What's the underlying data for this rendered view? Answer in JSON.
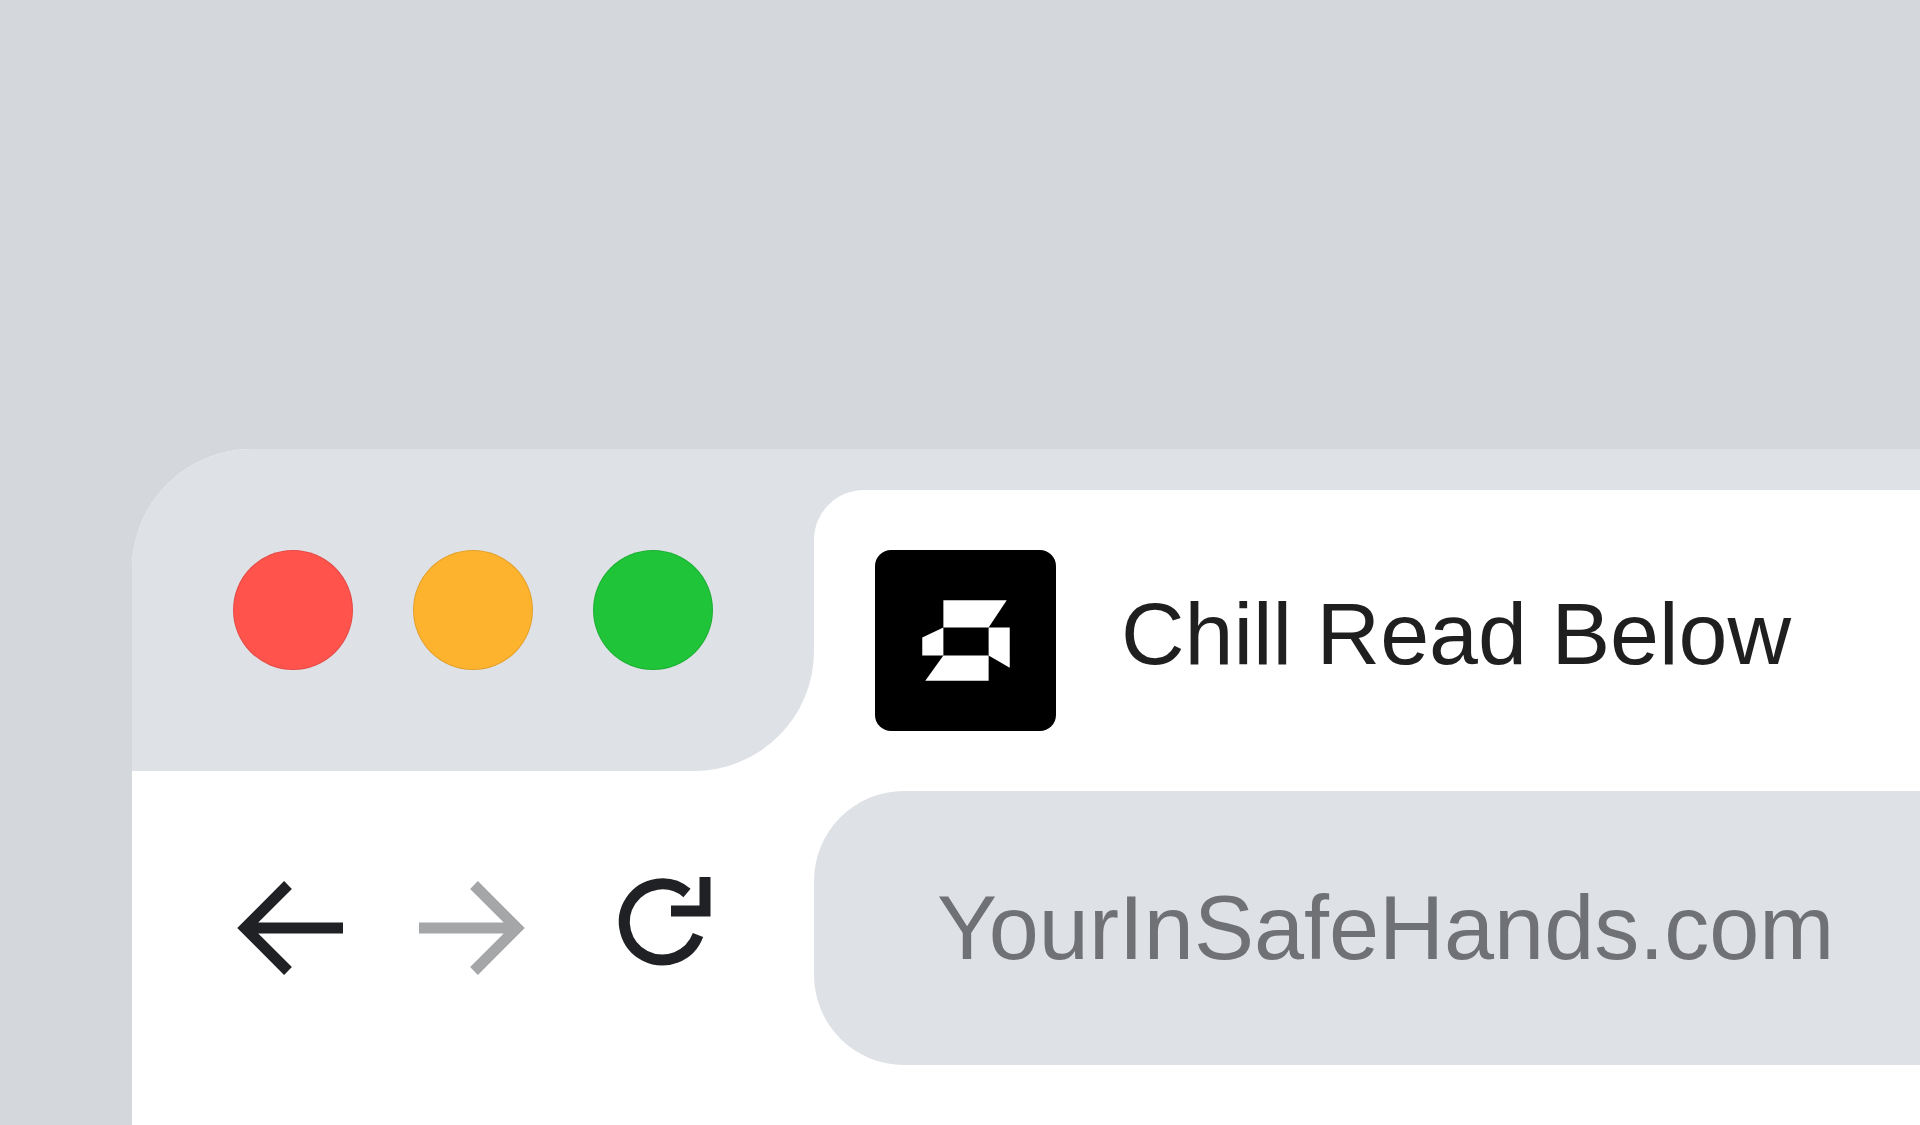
{
  "window_controls": [
    {
      "kind": "close"
    },
    {
      "kind": "minimize"
    },
    {
      "kind": "zoom"
    }
  ],
  "tab": {
    "title": "Chill Read Below",
    "selected": true
  },
  "navigation": [
    {
      "kind": "back",
      "disabled": false
    },
    {
      "kind": "forward",
      "disabled": true
    },
    {
      "kind": "reload",
      "disabled": false
    }
  ],
  "address_bar": {
    "value": "YourInSafeHands.com"
  }
}
